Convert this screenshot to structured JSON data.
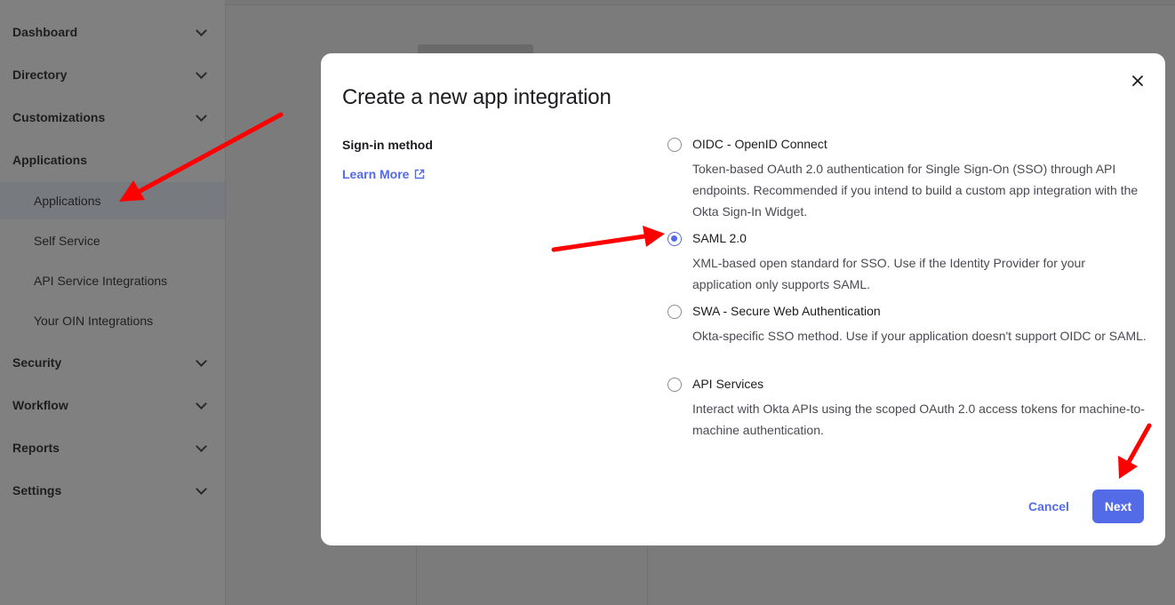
{
  "sidebar": {
    "sections": [
      {
        "label": "Dashboard"
      },
      {
        "label": "Directory"
      },
      {
        "label": "Customizations"
      },
      {
        "label": "Applications"
      },
      {
        "label": "Security"
      },
      {
        "label": "Workflow"
      },
      {
        "label": "Reports"
      },
      {
        "label": "Settings"
      }
    ],
    "applications_items": [
      {
        "label": "Applications"
      },
      {
        "label": "Self Service"
      },
      {
        "label": "API Service Integrations"
      },
      {
        "label": "Your OIN Integrations"
      }
    ]
  },
  "modal": {
    "title": "Create a new app integration",
    "close_icon": "close-icon",
    "field_label": "Sign-in method",
    "learn_more": "Learn More",
    "options": [
      {
        "title": "OIDC - OpenID Connect",
        "description": "Token-based OAuth 2.0 authentication for Single Sign-On (SSO) through API endpoints. Recommended if you intend to build a custom app integration with the Okta Sign-In Widget.",
        "checked": false
      },
      {
        "title": "SAML 2.0",
        "description": "XML-based open standard for SSO. Use if the Identity Provider for your application only supports SAML.",
        "checked": true
      },
      {
        "title": "SWA - Secure Web Authentication",
        "description": "Okta-specific SSO method. Use if your application doesn't support OIDC or SAML.",
        "checked": false
      },
      {
        "title": "API Services",
        "description": "Interact with Okta APIs using the scoped OAuth 2.0 access tokens for machine-to-machine authentication.",
        "checked": false
      }
    ],
    "cancel_label": "Cancel",
    "next_label": "Next"
  },
  "colors": {
    "accent": "#546be7",
    "annotation_arrow": "#ff0000",
    "overlay": "#808080"
  }
}
